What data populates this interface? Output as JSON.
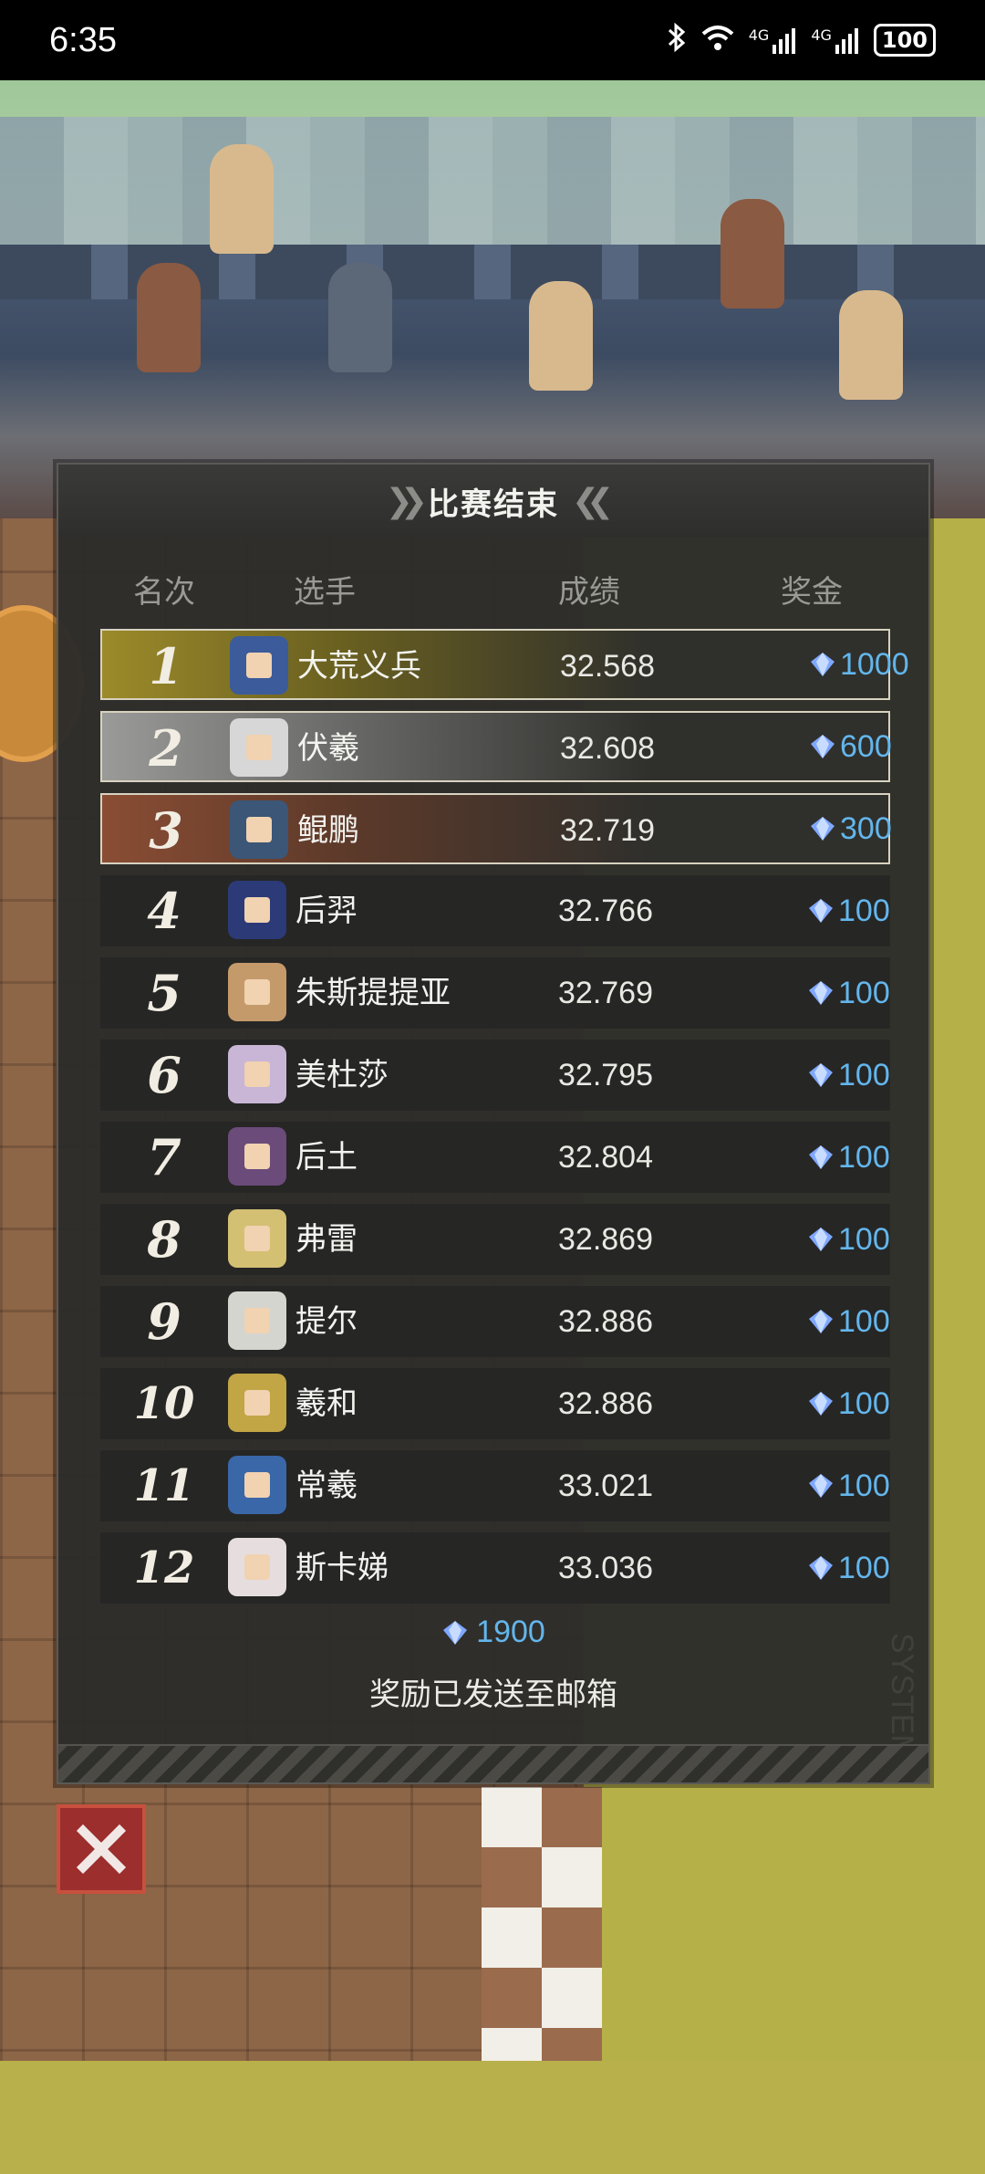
{
  "status_bar": {
    "time": "6:35",
    "network_1": "4G",
    "network_2": "4G",
    "battery": "100"
  },
  "dialog": {
    "title": "比赛结束",
    "columns": {
      "rank": "名次",
      "player": "选手",
      "score": "成绩",
      "prize": "奖金"
    },
    "rows": [
      {
        "rank": "1",
        "name": "大荒义兵",
        "score": "32.568",
        "prize": "1000",
        "avatar_color": "#3b5b9a"
      },
      {
        "rank": "2",
        "name": "伏羲",
        "score": "32.608",
        "prize": "600",
        "avatar_color": "#d7d7d7"
      },
      {
        "rank": "3",
        "name": "鲲鹏",
        "score": "32.719",
        "prize": "300",
        "avatar_color": "#3b5677"
      },
      {
        "rank": "4",
        "name": "后羿",
        "score": "32.766",
        "prize": "100",
        "avatar_color": "#2c3a78"
      },
      {
        "rank": "5",
        "name": "朱斯提提亚",
        "score": "32.769",
        "prize": "100",
        "avatar_color": "#c59a6b"
      },
      {
        "rank": "6",
        "name": "美杜莎",
        "score": "32.795",
        "prize": "100",
        "avatar_color": "#c9b6d6"
      },
      {
        "rank": "7",
        "name": "后土",
        "score": "32.804",
        "prize": "100",
        "avatar_color": "#6b4b7a"
      },
      {
        "rank": "8",
        "name": "弗雷",
        "score": "32.869",
        "prize": "100",
        "avatar_color": "#d4c073"
      },
      {
        "rank": "9",
        "name": "提尔",
        "score": "32.886",
        "prize": "100",
        "avatar_color": "#d5d5d0"
      },
      {
        "rank": "10",
        "name": "羲和",
        "score": "32.886",
        "prize": "100",
        "avatar_color": "#c2a545"
      },
      {
        "rank": "11",
        "name": "常羲",
        "score": "33.021",
        "prize": "100",
        "avatar_color": "#3a67a8"
      },
      {
        "rank": "12",
        "name": "斯卡娣",
        "score": "33.036",
        "prize": "100",
        "avatar_color": "#e6dede"
      }
    ],
    "total_prize": "1900",
    "mail_note": "奖励已发送至邮箱",
    "watermark": "SYSTEM"
  },
  "colors": {
    "prize_text": "#63b6ec",
    "gem": "#7fa8ff",
    "close_button": "#9c2e2e"
  },
  "icons": {
    "gem": "diamond-gem-icon",
    "close": "close-x-icon"
  }
}
